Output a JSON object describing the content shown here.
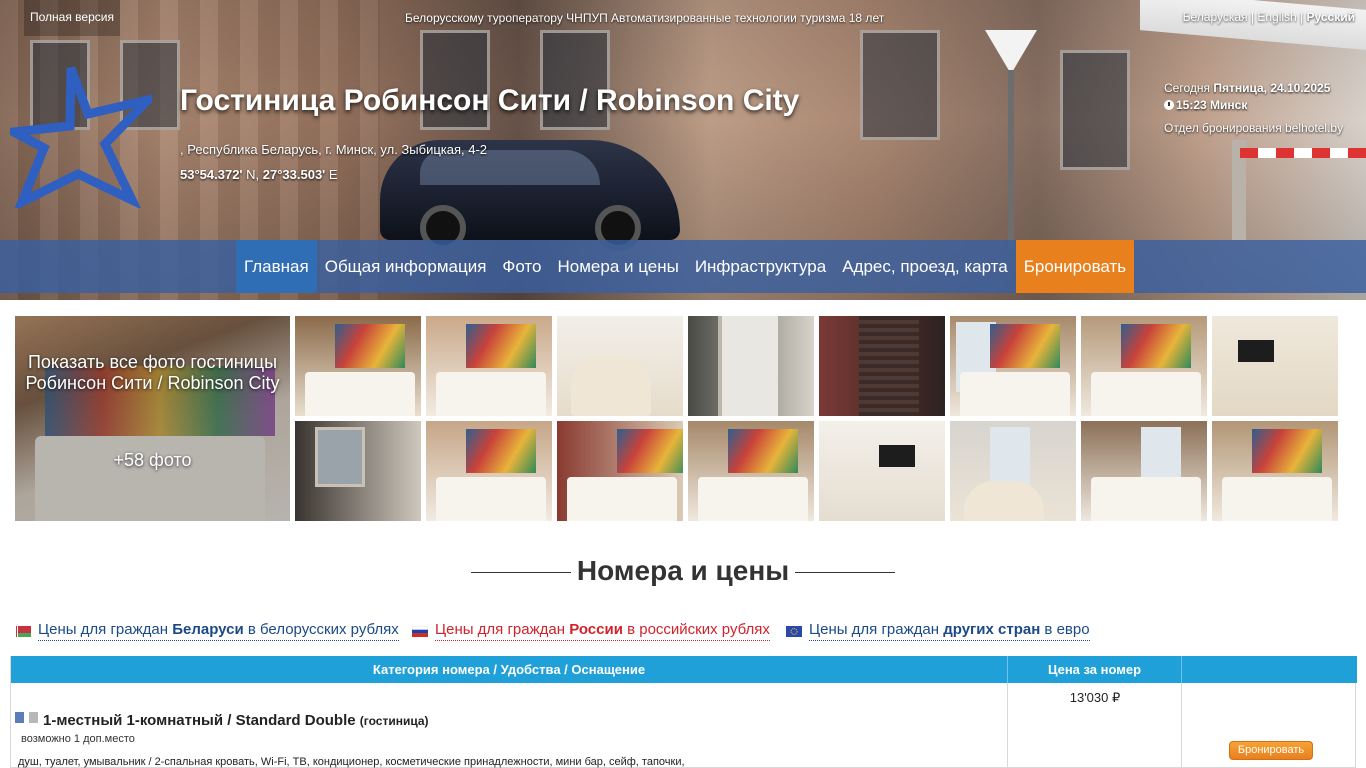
{
  "topbar": {
    "full_version": "Полная версия",
    "announcement": "Белорусскому туроператору ЧНПУП Автоматизированные технологии туризма 18 лет",
    "lang_by": "Беларуская",
    "lang_sep1": " | ",
    "lang_en": "English",
    "lang_sep2": " | ",
    "lang_ru": "Русский"
  },
  "hotel": {
    "title": "Гостиница Робинсон Сити / Robinson City",
    "address": ", Республика Беларусь, г. Минск, ул. Зыбицкая, 4-2",
    "lat": "53°54.372'",
    "lat_dir": " N, ",
    "lon": "27°33.503'",
    "lon_dir": " E"
  },
  "datebox": {
    "today_label": "Сегодня ",
    "date": "Пятница, 24.10.2025",
    "time": "15:23 Минск",
    "bureau": "Отдел бронирования belhotel.by"
  },
  "nav": {
    "items": [
      "Главная",
      "Общая информация",
      "Фото",
      "Номера и цены",
      "Инфраструктура",
      "Адрес, проезд, карта",
      "Бронировать"
    ]
  },
  "gallery": {
    "show_all": "Показать все фото гостиницы Робинсон Сити / Robinson City",
    "more": "+58 фото"
  },
  "rooms": {
    "section_title": "Номера и цены",
    "tab_by": {
      "pre": "Цены для граждан ",
      "bold": "Беларуси",
      "post": " в белорусских рублях"
    },
    "tab_ru": {
      "pre": "Цены для граждан ",
      "bold": "России",
      "post": " в российских рублях"
    },
    "tab_eu": {
      "pre": "Цены для граждан ",
      "bold": "других стран",
      "post": " в евро"
    },
    "columns": [
      "Категория номера / Удобства / Оснащение",
      "Цена за номер",
      ""
    ],
    "room": {
      "name": "1-местный 1-комнатный / Standard Double",
      "type": "(гостиница)",
      "extra": "возможно 1 доп.место",
      "amenities": "душ, туалет, умывальник / 2-спальная кровать, Wi-Fi, ТВ, кондиционер, косметические принадлежности, мини бар, сейф, тапочки,",
      "price": "13'030 ₽",
      "book": "Бронировать"
    }
  },
  "colors": {
    "nav_bg": "#395fa0",
    "nav_active": "#2f6eb5",
    "nav_book": "#e8801e",
    "table_head": "#1fa0d8",
    "link_blue": "#1b4a86",
    "link_red": "#d0232a"
  }
}
